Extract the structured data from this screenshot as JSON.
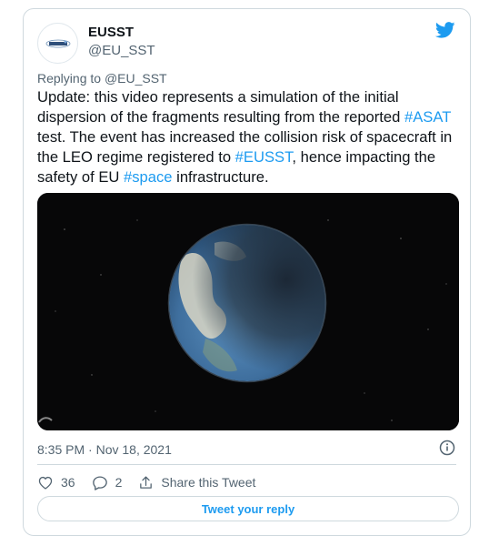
{
  "author": {
    "name": "EUSST",
    "handle": "@EU_SST"
  },
  "replying": {
    "prefix": "Replying to ",
    "handle": "@EU_SST"
  },
  "tweet": {
    "t1": "Update: this video represents a simulation of the initial dispersion of the fragments resulting from the reported ",
    "tag_asat": "#ASAT",
    "t2": " test. The event has increased the collision risk of spacecraft in the LEO regime registered to ",
    "tag_eusst": "#EUSST",
    "t3": ", hence impacting the safety of EU ",
    "tag_space": "#space",
    "t4": " infrastructure."
  },
  "timestamp": "8:35 PM · Nov 18, 2021",
  "actions": {
    "likes": "36",
    "replies": "2",
    "share_label": "Share this Tweet"
  },
  "reply_button_label": "Tweet your reply",
  "colors": {
    "accent": "#1d9bf0",
    "muted": "#536471",
    "border": "#cfd9de"
  },
  "icons": [
    "twitter-bird-icon",
    "info-icon",
    "heart-icon",
    "reply-icon",
    "share-icon"
  ]
}
